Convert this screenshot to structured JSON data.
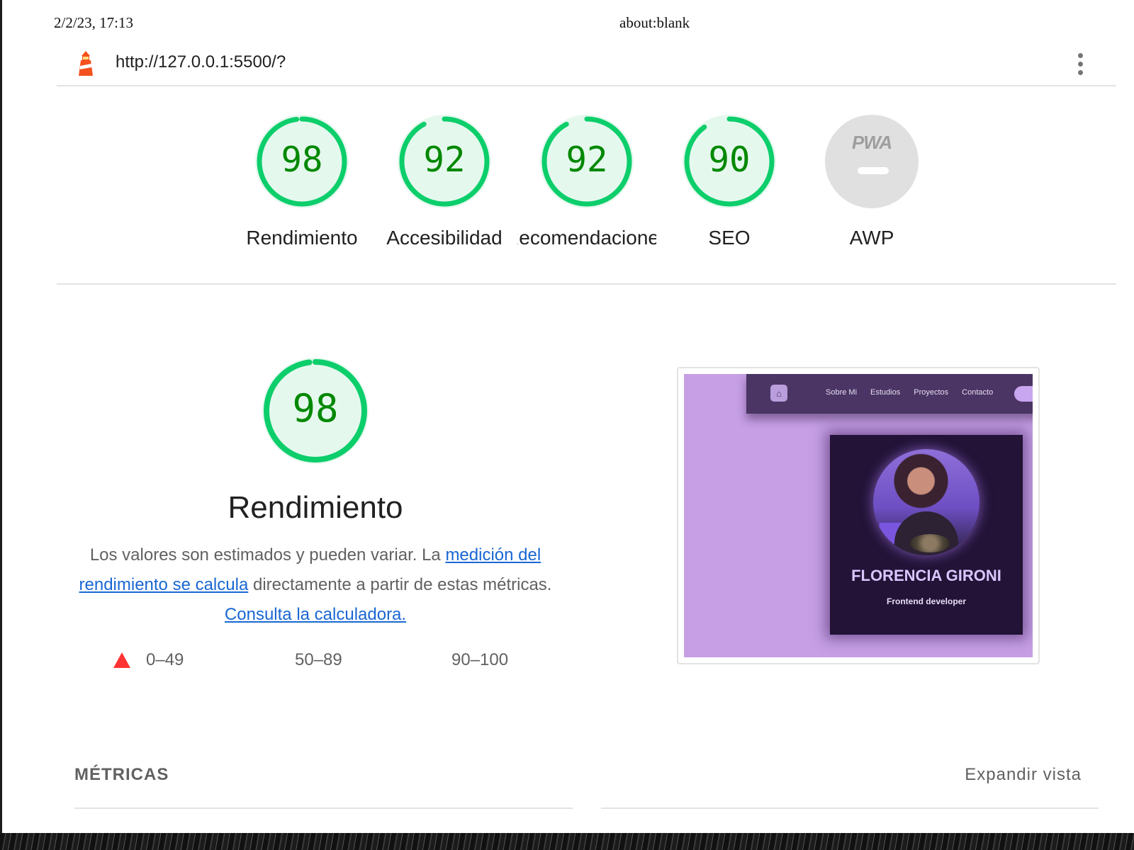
{
  "print_header": {
    "date": "2/2/23, 17:13",
    "title": "about:blank"
  },
  "topbar": {
    "url": "http://127.0.0.1:5500/?",
    "menu_icon": "more-vert-icon",
    "logo_icon": "lighthouse-icon"
  },
  "colors": {
    "pass": "#0cce6b",
    "pass_bg": "#e5f8ee",
    "pass_text": "#008800",
    "neutral_bg": "#e0e0e0",
    "fail": "#ff3333",
    "link": "#1967d2"
  },
  "gauges": [
    {
      "score": "98",
      "value": 0.98,
      "label": "Rendimiento"
    },
    {
      "score": "92",
      "value": 0.92,
      "label": "Accesibilidad"
    },
    {
      "score": "92",
      "value": 0.92,
      "label": "Recomendaciones"
    },
    {
      "score": "90",
      "value": 0.9,
      "label": "SEO"
    },
    {
      "score": "",
      "value": null,
      "label": "AWP",
      "badge": "PWA"
    }
  ],
  "performance": {
    "score": "98",
    "value": 0.98,
    "title": "Rendimiento",
    "desc_part1": "Los valores son estimados y pueden variar. La ",
    "desc_link1": "medición del rendimiento se calcula",
    "desc_part2": " directamente a partir de estas métricas. ",
    "desc_link2": "Consulta la calculadora."
  },
  "legend": [
    {
      "range": "0–49",
      "shape": "triangle",
      "color": "#ff3333"
    },
    {
      "range": "50–89",
      "shape": "square",
      "color": "#ffaa33"
    },
    {
      "range": "90–100",
      "shape": "circle",
      "color": "#0cce6b"
    }
  ],
  "screenshot": {
    "nav": [
      "Sobre Mi",
      "Estudios",
      "Proyectos",
      "Contacto"
    ],
    "home_icon": "home-icon",
    "name": "FLORENCIA GIRONI",
    "role": "Frontend developer"
  },
  "metrics": {
    "title": "MÉTRICAS",
    "expand": "Expandir vista"
  }
}
